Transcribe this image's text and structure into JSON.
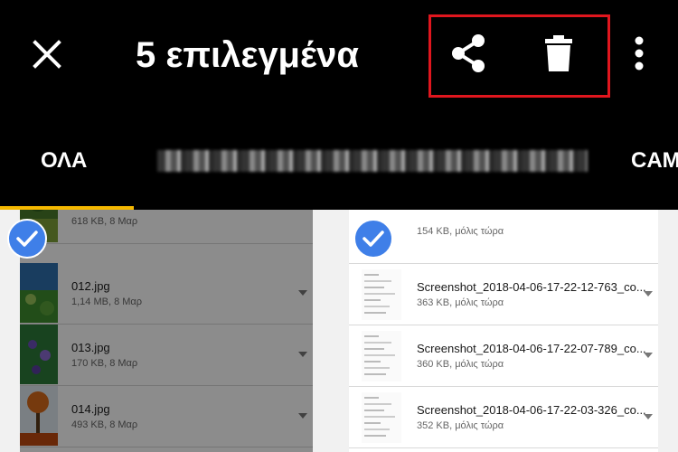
{
  "appbar": {
    "title": "5 επιλεγμένα",
    "icons": {
      "close": "close-icon",
      "share": "share-icon",
      "delete": "delete-icon",
      "more": "more-vert-icon"
    }
  },
  "tabs": [
    {
      "label": "ΟΛΑ",
      "active": true
    },
    {
      "label": "",
      "blurred": true
    },
    {
      "label": "CAM"
    }
  ],
  "colors": {
    "accent": "#f5b800",
    "check": "#3f7fe8",
    "highlight": "#e0161e",
    "appbar": "#000000"
  },
  "left_items": [
    {
      "name": "",
      "meta": "618 KB, 8 Μαρ"
    },
    {
      "name": "012.jpg",
      "meta": "1,14 MB, 8 Μαρ"
    },
    {
      "name": "013.jpg",
      "meta": "170 KB, 8 Μαρ"
    },
    {
      "name": "014.jpg",
      "meta": "493 KB, 8 Μαρ"
    }
  ],
  "right_items": [
    {
      "name": "",
      "meta": "154 KB, μόλις τώρα"
    },
    {
      "name": "Screenshot_2018-04-06-17-22-12-763_co...",
      "meta": "363 KB, μόλις τώρα"
    },
    {
      "name": "Screenshot_2018-04-06-17-22-07-789_co...",
      "meta": "360 KB, μόλις τώρα"
    },
    {
      "name": "Screenshot_2018-04-06-17-22-03-326_co...",
      "meta": "352 KB, μόλις τώρα"
    }
  ]
}
